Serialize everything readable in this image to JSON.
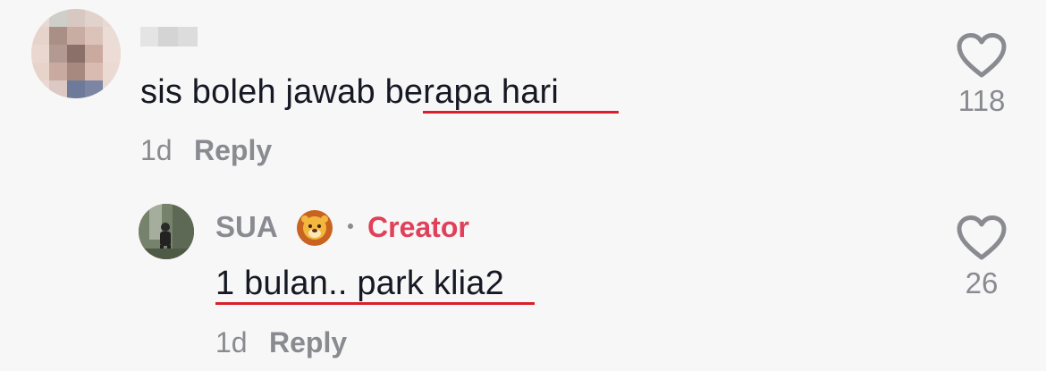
{
  "comment": {
    "text_plain": "sis boleh jawab ",
    "text_highlight": "berapa hari",
    "age": "1d",
    "reply_label": "Reply",
    "like_count": "118"
  },
  "reply": {
    "username": "SUA",
    "username_emoji": "lion-face-emoji",
    "separator": "·",
    "creator_badge": "Creator",
    "text": "1 bulan.. park klia2",
    "age": "1d",
    "reply_label": "Reply",
    "like_count": "26"
  },
  "colors": {
    "background": "#f7f7f7",
    "text": "#161823",
    "muted": "#8a8b91",
    "creator": "#e0405a",
    "annotation_underline": "#d8202c"
  },
  "icons": {
    "like": "heart-outline-icon"
  }
}
